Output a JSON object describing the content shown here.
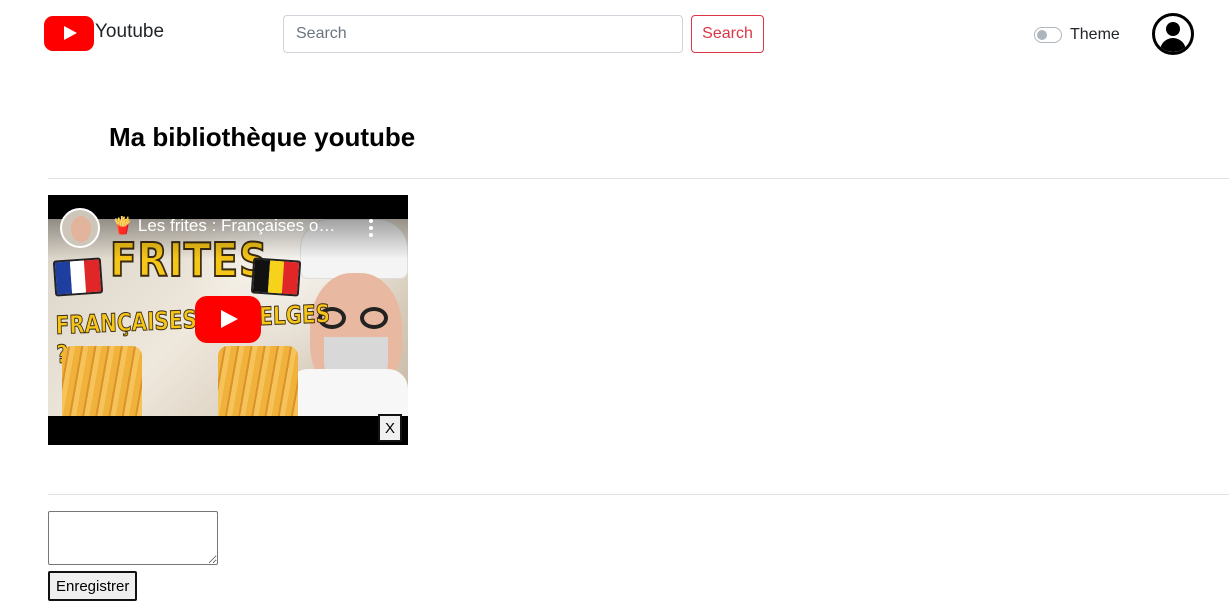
{
  "header": {
    "brand": "Youtube",
    "search_placeholder": "Search",
    "search_value": "",
    "search_button": "Search",
    "theme_label": "Theme",
    "theme_enabled": false
  },
  "library": {
    "title": "Ma bibliothèque youtube"
  },
  "video": {
    "title": "🍟 Les frites : Françaises o…",
    "thumbnail_text_top": "FRITES",
    "thumbnail_text_bottom": "FRANÇAISES OU BELGES ?",
    "close_label": "X"
  },
  "form": {
    "textarea_value": "",
    "save_button": "Enregistrer"
  },
  "colors": {
    "brand_red": "#ff0000",
    "danger": "#dc3545"
  }
}
